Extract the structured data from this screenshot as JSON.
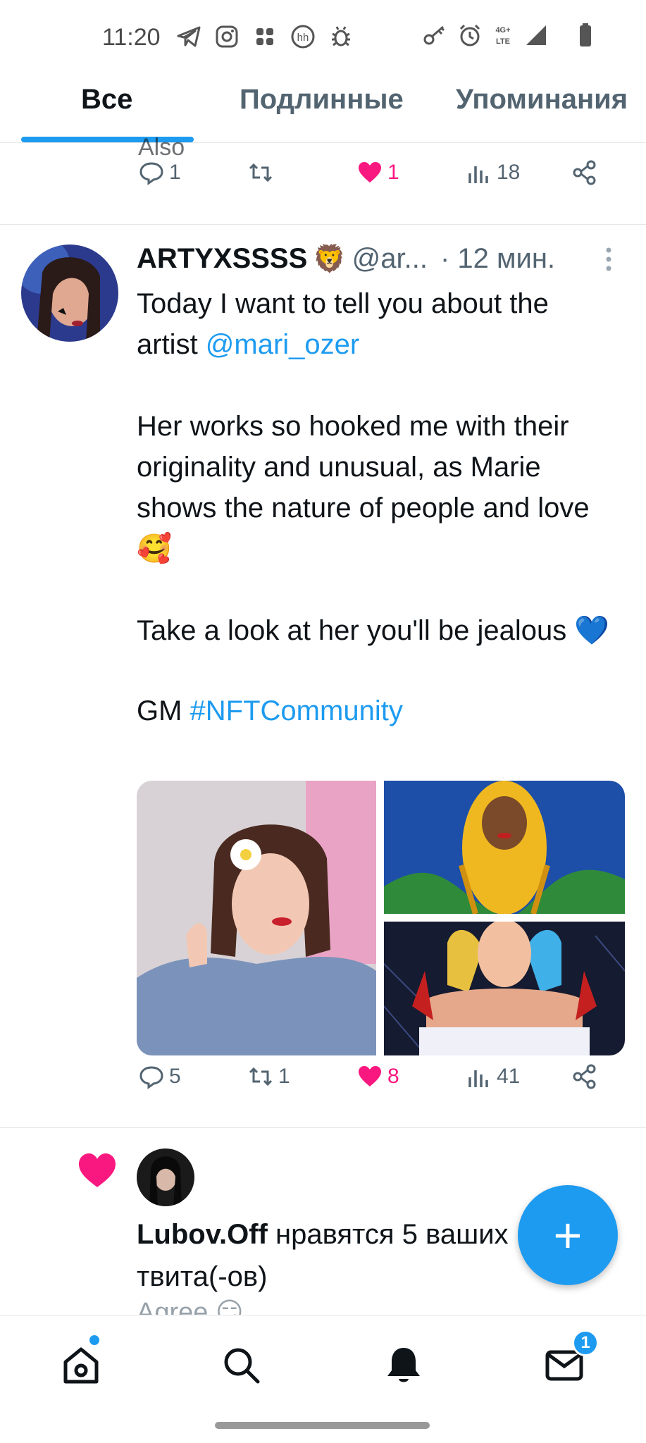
{
  "status_bar": {
    "time": "11:20",
    "network": "4G+ LTE",
    "left_icons": [
      "telegram-icon",
      "instagram-icon",
      "grid-app-icon",
      "hh-icon",
      "bug-icon"
    ],
    "right_icons": [
      "key-icon",
      "alarm-icon",
      "signal-icon",
      "battery-icon"
    ]
  },
  "tabs": [
    {
      "label": "Все",
      "active": true
    },
    {
      "label": "Подлинные",
      "active": false
    },
    {
      "label": "Упоминания",
      "active": false
    }
  ],
  "previous_tweet": {
    "peek_text": "Also",
    "stats": {
      "replies": "1",
      "retweets": "",
      "likes": "1",
      "views": "18"
    }
  },
  "tweet": {
    "display_name": "ARTYXSSSS",
    "name_emoji": "🦁",
    "handle": "@ar...",
    "time": "· 12 мин.",
    "text_line1_a": "Today I want to tell you about the artist ",
    "mention": "@mari_ozer",
    "paragraph2": "Her works so hooked me with their originality and unusual, as Marie shows the nature of people and love🥰",
    "paragraph3": "Take a look at her you'll be jealous 💙",
    "text_gm": "GM ",
    "hashtag": "#NFTCommunity",
    "stats": {
      "replies": "5",
      "retweets": "1",
      "likes": "8",
      "views": "41"
    }
  },
  "notification": {
    "user": "Lubov.Off",
    "text": " нравятся 5 ваших твита(-ов)",
    "peek_text": "Agree 😏"
  },
  "fab": {
    "label": "+"
  },
  "bottom_nav": {
    "items": [
      "home-icon",
      "search-icon",
      "bell-icon",
      "mail-icon"
    ],
    "messages_badge": "1"
  },
  "colors": {
    "accent": "#1d9bf0",
    "like": "#f91880",
    "text": "#0f1419",
    "secondary": "#536471"
  }
}
